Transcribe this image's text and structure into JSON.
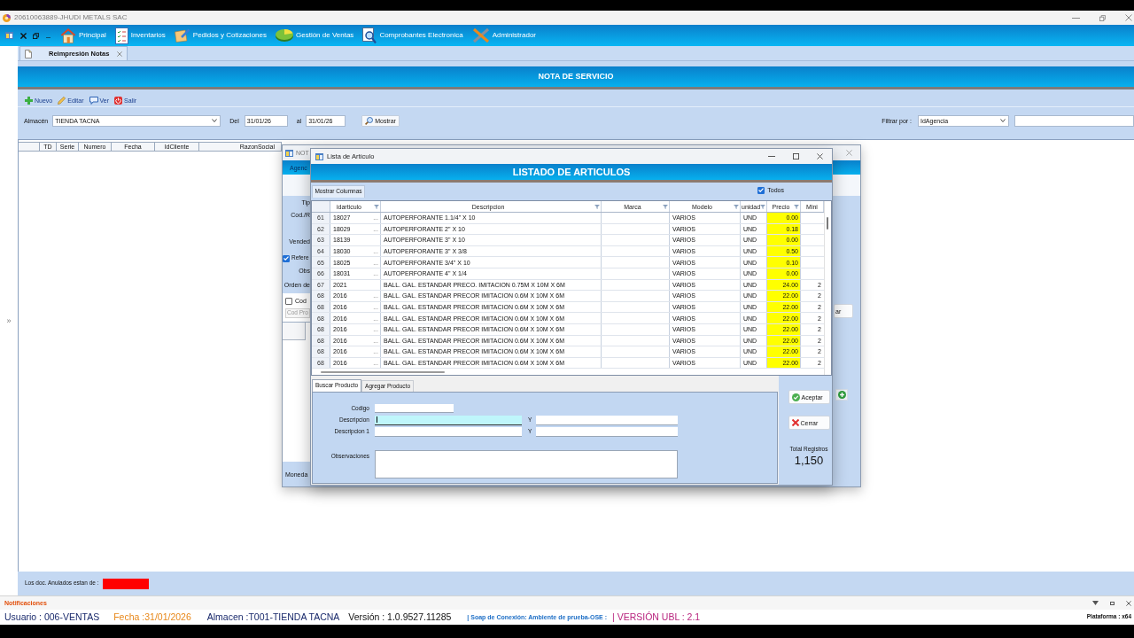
{
  "window": {
    "title": "20610063889-JHUDI METALS SAC"
  },
  "menu": [
    "Principal",
    "Inventarios",
    "Pedidos y Cotizaciones",
    "Gestión de Ventas",
    "Comprobantes Electronica",
    "Administrador"
  ],
  "side_toggle": "»",
  "tabs": [
    {
      "label": "Reimpresión Notas",
      "selected": true
    }
  ],
  "header": {
    "title": "NOTA DE SERVICIO"
  },
  "toolbar": [
    "Nuevo",
    "Editar",
    "Ver",
    "Salir"
  ],
  "filters": {
    "store": {
      "label": "Almacén",
      "value": "TIENDA TACNA"
    },
    "from": {
      "label": "Del",
      "value": "31/01/26"
    },
    "to": {
      "label": "al",
      "value": "31/01/26"
    },
    "show_button": "Mostrar",
    "filter_by": {
      "label": "Filtrar por :",
      "value": "IdAgencia"
    }
  },
  "main_table": {
    "columns": [
      "TD",
      "Serie",
      "Numero",
      "Fecha",
      "IdCliente",
      "RazonSocial"
    ]
  },
  "legend": {
    "label": "Los doc. Anulados estan de :",
    "color": "#ff0000"
  },
  "notifications": {
    "title": "Notificaciones"
  },
  "status_bar": {
    "items": [
      {
        "kind": "user",
        "text": "Usuario : 006-VENTAS"
      },
      {
        "kind": "date",
        "text": "Fecha :31/01/2026"
      },
      {
        "kind": "store",
        "text": "Almacen :T001-TIENDA TACNA"
      },
      {
        "kind": "version",
        "text": "Versión : 1.0.9527.11285"
      },
      {
        "kind": "soap",
        "text": "| Soap de Conexión: Ambiente de prueba-OSE :"
      },
      {
        "kind": "ubl",
        "text": "| VERSIÓN UBL : 2.1"
      }
    ],
    "platform": "Plataforma : x64"
  },
  "behind_dialog": {
    "title": "NOT",
    "band": "Agenc",
    "labels": [
      "Tip",
      "Cod./R",
      "Vended"
    ],
    "reference": {
      "label": "Refere",
      "checked": true
    },
    "labels_2": [
      "Obs",
      "Orden de"
    ],
    "code_check": {
      "label": "Cod",
      "checked": false
    },
    "code_field": {
      "placeholder": "Cod Pro"
    },
    "side_button": "ar",
    "footer_label": "Moneda"
  },
  "dialog": {
    "title": "Lista de Artículo",
    "header": "LISTADO DE ARTICULOS",
    "columns_button": "Mostrar Columnas",
    "all_check": {
      "label": "Todos",
      "checked": true
    },
    "table": {
      "columns": [
        {
          "label": "idarticulo",
          "filter": true
        },
        {
          "label": "Descripcion",
          "filter": true
        },
        {
          "label": "Marca",
          "filter": true
        },
        {
          "label": "Modelo",
          "filter": true
        },
        {
          "label": "unidad",
          "filter": true
        },
        {
          "label": "Precio",
          "filter": true
        },
        {
          "label": "Mini",
          "filter": false
        }
      ],
      "rows": [
        {
          "n": "61",
          "id": "18027",
          "more": "...",
          "descripcion": "AUTOPERFORANTE 1.1/4\" X 10",
          "modelo": "VARIOS",
          "unidad": "UND",
          "precio": "0.00"
        },
        {
          "n": "62",
          "id": "18029",
          "more": "...",
          "descripcion": "AUTOPERFORANTE 2\" X 10",
          "modelo": "VARIOS",
          "unidad": "UND",
          "precio": "0.18"
        },
        {
          "n": "63",
          "id": "18139",
          "descripcion": "AUTOPERFORANTE 3\" X 10",
          "modelo": "VARIOS",
          "unidad": "UND",
          "precio": "0.00"
        },
        {
          "n": "64",
          "id": "18030",
          "more": "...",
          "descripcion": "AUTOPERFORANTE 3\" X 3/8",
          "modelo": "VARIOS",
          "unidad": "UND",
          "precio": "0.50"
        },
        {
          "n": "65",
          "id": "18025",
          "more": "...",
          "descripcion": "AUTOPERFORANTE 3/4\" X 10",
          "modelo": "VARIOS",
          "unidad": "UND",
          "precio": "0.10"
        },
        {
          "n": "66",
          "id": "18031",
          "more": "...",
          "descripcion": "AUTOPERFORANTE 4\" X 1/4",
          "modelo": "VARIOS",
          "unidad": "UND",
          "precio": "0.00"
        },
        {
          "n": "67",
          "id": "2021",
          "descripcion": "BALL. GAL. ESTANDAR PRECO. IMITACION 0.75M X 10M X 6M",
          "modelo": "VARIOS",
          "unidad": "UND",
          "precio": "24.00",
          "minimo": "2"
        },
        {
          "n": "68",
          "id": "2016",
          "more": "...",
          "descripcion": "BALL. GAL. ESTANDAR PRECOR IMITACION 0.6M X 10M X 6M",
          "modelo": "VARIOS",
          "unidad": "UND",
          "precio": "22.00",
          "minimo": "2"
        },
        {
          "n": "68",
          "id": "2016",
          "more": "...",
          "descripcion": "BALL. GAL. ESTANDAR PRECOR IMITACION 0.6M X 10M X 6M",
          "modelo": "VARIOS",
          "unidad": "UND",
          "precio": "22.00",
          "minimo": "2"
        },
        {
          "n": "68",
          "id": "2016",
          "more": "...",
          "descripcion": "BALL. GAL. ESTANDAR PRECOR IMITACION 0.6M X 10M X 6M",
          "modelo": "VARIOS",
          "unidad": "UND",
          "precio": "22.00",
          "minimo": "2"
        },
        {
          "n": "68",
          "id": "2016",
          "more": "...",
          "descripcion": "BALL. GAL. ESTANDAR PRECOR IMITACION 0.6M X 10M X 6M",
          "modelo": "VARIOS",
          "unidad": "UND",
          "precio": "22.00",
          "minimo": "2"
        },
        {
          "n": "68",
          "id": "2016",
          "more": "...",
          "descripcion": "BALL. GAL. ESTANDAR PRECOR IMITACION 0.6M X 10M X 6M",
          "modelo": "VARIOS",
          "unidad": "UND",
          "precio": "22.00",
          "minimo": "2"
        },
        {
          "n": "68",
          "id": "2016",
          "more": "...",
          "descripcion": "BALL. GAL. ESTANDAR PRECOR IMITACION 0.6M X 10M X 6M",
          "modelo": "VARIOS",
          "unidad": "UND",
          "precio": "22.00",
          "minimo": "2"
        },
        {
          "n": "68",
          "id": "2016",
          "more": "...",
          "descripcion": "BALL. GAL. ESTANDAR PRECOR IMITACION 0.6M X 10M X 6M",
          "modelo": "VARIOS",
          "unidad": "UND",
          "precio": "22.00",
          "minimo": "2"
        }
      ]
    },
    "search": {
      "tabs": [
        {
          "label": "Buscar Producto",
          "selected": true
        },
        {
          "label": "Agregar Producto",
          "selected": false
        }
      ],
      "fields": [
        {
          "kind": "short",
          "label": "Codigo",
          "focused": false
        },
        {
          "kind": "pair",
          "label": "Descripcion",
          "joiner": "Y",
          "focused": true
        },
        {
          "kind": "pair",
          "label": "Descripcion 1",
          "joiner": "Y",
          "focused": false
        },
        {
          "kind": "area",
          "label": "Observaciones",
          "focused": false
        }
      ]
    },
    "buttons": [
      "Aceptar",
      "Cerrar"
    ],
    "total": {
      "label": "Total Registros",
      "value": "1,150"
    }
  }
}
